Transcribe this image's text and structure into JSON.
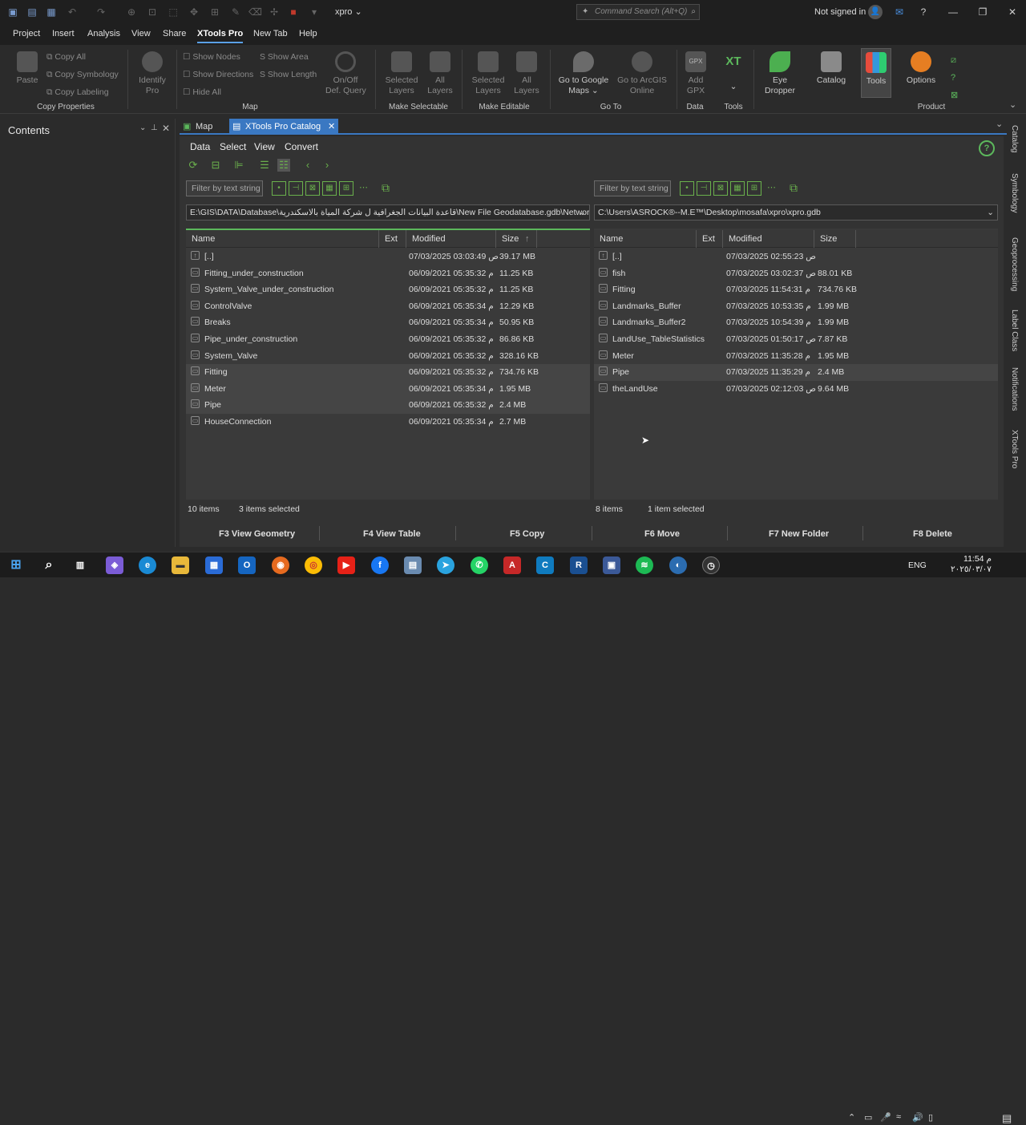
{
  "app": {
    "project_name": "xpro",
    "command_search_placeholder": "Command Search (Alt+Q)",
    "signin": "Not signed in"
  },
  "menu": [
    "Project",
    "Insert",
    "Analysis",
    "View",
    "Share",
    "XTools Pro",
    "New Tab",
    "Help"
  ],
  "ribbon": {
    "copy": {
      "paste": "Paste",
      "copy_all": "Copy All",
      "copy_symbology": "Copy Symbology",
      "copy_labeling": "Copy Labeling",
      "group": "Copy Properties"
    },
    "identify": "Identify\nPro",
    "map": {
      "show_nodes": "Show Nodes",
      "show_area": "Show Area",
      "show_directions": "Show Directions",
      "show_length": "Show Length",
      "hide_all": "Hide All",
      "onoff": "On/Off\nDef. Query",
      "group": "Map"
    },
    "selectable": {
      "selected": "Selected\nLayers",
      "all": "All\nLayers",
      "group": "Make Selectable"
    },
    "editable": {
      "selected": "Selected\nLayers",
      "all": "All\nLayers",
      "group": "Make Editable"
    },
    "goto": {
      "google": "Go to Google\nMaps ⌄",
      "arcgis": "Go to ArcGIS\nOnline",
      "group": "Go To"
    },
    "data": {
      "add_gpx": "Add\nGPX",
      "gpx_badge": "GPX",
      "group": "Data"
    },
    "tools": {
      "xt": "XT",
      "group": "Tools"
    },
    "eye": "Eye\nDropper",
    "catalog": "Catalog",
    "tools_btn": "Tools",
    "options": "Options",
    "product_group": "Product"
  },
  "contents": {
    "title": "Contents"
  },
  "tabs": {
    "map": "Map",
    "catalog": "XTools Pro Catalog"
  },
  "catalog": {
    "menu": [
      "Data",
      "Select",
      "View",
      "Convert"
    ],
    "filter_placeholder": "Filter by text string",
    "left": {
      "path": "E:\\GIS\\DATA\\Database\\قاعدة البيانات الجغرافية ل شركة المياة بالاسكندرية\\New File Geodatabase.gdb\\Network",
      "columns": [
        "Name",
        "Ext",
        "Modified",
        "Size"
      ],
      "rows": [
        {
          "name": "[..]",
          "modified": "07/03/2025 03:03:49 ص",
          "size": "39.17 MB"
        },
        {
          "name": "Fitting_under_construction",
          "modified": "06/09/2021 05:35:32 م",
          "size": "11.25 KB"
        },
        {
          "name": "System_Valve_under_construction",
          "modified": "06/09/2021 05:35:32 م",
          "size": "11.25 KB"
        },
        {
          "name": "ControlValve",
          "modified": "06/09/2021 05:35:34 م",
          "size": "12.29 KB"
        },
        {
          "name": "Breaks",
          "modified": "06/09/2021 05:35:34 م",
          "size": "50.95 KB"
        },
        {
          "name": "Pipe_under_construction",
          "modified": "06/09/2021 05:35:32 م",
          "size": "86.86 KB"
        },
        {
          "name": "System_Valve",
          "modified": "06/09/2021 05:35:32 م",
          "size": "328.16 KB"
        },
        {
          "name": "Fitting",
          "modified": "06/09/2021 05:35:32 م",
          "size": "734.76 KB"
        },
        {
          "name": "Meter",
          "modified": "06/09/2021 05:35:34 م",
          "size": "1.95 MB"
        },
        {
          "name": "Pipe",
          "modified": "06/09/2021 05:35:32 م",
          "size": "2.4 MB"
        },
        {
          "name": "HouseConnection",
          "modified": "06/09/2021 05:35:34 م",
          "size": "2.7 MB"
        }
      ],
      "count": "10 items",
      "selected": "3 items selected"
    },
    "right": {
      "path": "C:\\Users\\ASROCK®--M.E™\\Desktop\\mosafa\\xpro\\xpro.gdb",
      "columns": [
        "Name",
        "Ext",
        "Modified",
        "Size"
      ],
      "rows": [
        {
          "name": "[..]",
          "modified": "07/03/2025 02:55:23 ص",
          "size": ""
        },
        {
          "name": "fish",
          "modified": "07/03/2025 03:02:37 ص",
          "size": "88.01 KB"
        },
        {
          "name": "Fitting",
          "modified": "07/03/2025 11:54:31 م",
          "size": "734.76 KB"
        },
        {
          "name": "Landmarks_Buffer",
          "modified": "07/03/2025 10:53:35 م",
          "size": "1.99 MB"
        },
        {
          "name": "Landmarks_Buffer2",
          "modified": "07/03/2025 10:54:39 م",
          "size": "1.99 MB"
        },
        {
          "name": "LandUse_TableStatistics",
          "modified": "07/03/2025 01:50:17 ص",
          "size": "7.87 KB"
        },
        {
          "name": "Meter",
          "modified": "07/03/2025 11:35:28 م",
          "size": "1.95 MB"
        },
        {
          "name": "Pipe",
          "modified": "07/03/2025 11:35:29 م",
          "size": "2.4 MB"
        },
        {
          "name": "theLandUse",
          "modified": "07/03/2025 02:12:03 ص",
          "size": "9.64 MB"
        }
      ],
      "count": "8 items",
      "selected": "1 item selected"
    },
    "fkeys": [
      "F3 View Geometry",
      "F4 View Table",
      "F5 Copy",
      "F6 Move",
      "F7 New Folder",
      "F8 Delete"
    ]
  },
  "sidebar_tabs": [
    "Catalog",
    "Symbology",
    "Geoprocessing",
    "Label Class",
    "Notifications",
    "XTools Pro"
  ],
  "taskbar": {
    "lang": "ENG",
    "time": "11:54 م",
    "date": "٢٠٢٥/٠٣/٠٧"
  }
}
